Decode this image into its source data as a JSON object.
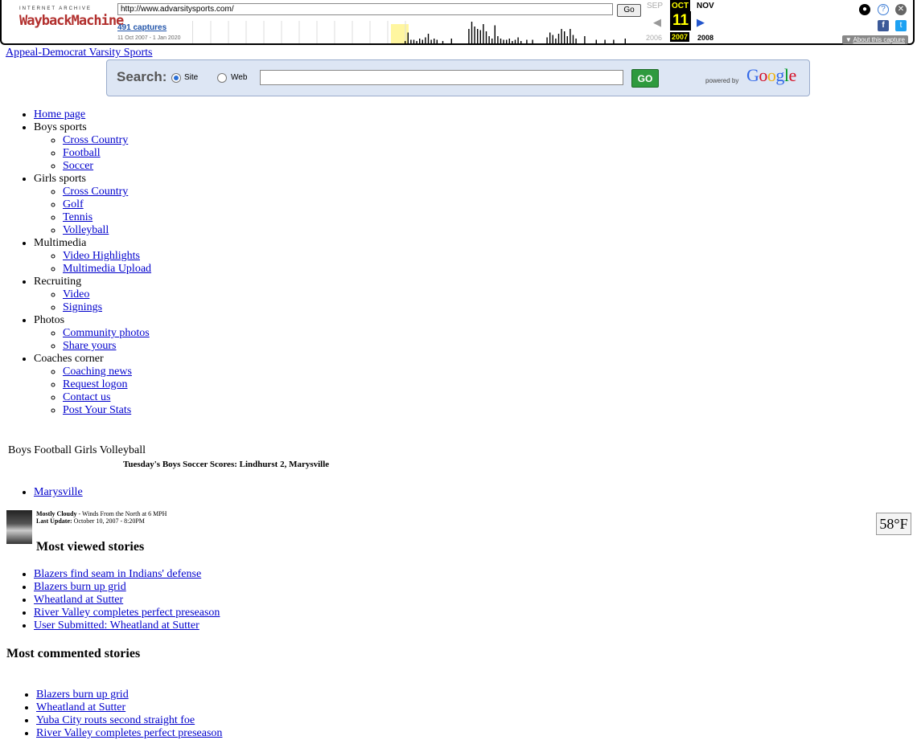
{
  "wayback": {
    "logo_top": "INTERNET ARCHIVE",
    "logo_main": "WaybackMachine",
    "url": "http://www.advarsitysports.com/",
    "go": "Go",
    "captures": "491 captures",
    "range": "11 Oct 2007 - 1 Jan 2020",
    "prev_month": "SEP",
    "cur_month": "OCT",
    "next_month": "NOV",
    "day": "11",
    "prev_year": "2006",
    "cur_year": "2007",
    "next_year": "2008",
    "about": "About this capture",
    "capture_histogram": [
      0,
      0,
      0,
      0,
      0,
      0,
      0,
      0,
      0,
      0,
      0,
      0,
      0,
      0,
      0,
      0,
      0,
      0,
      0,
      0,
      0,
      0,
      0,
      0,
      0,
      0,
      0,
      0,
      0,
      0,
      0,
      0,
      0,
      0,
      0,
      0,
      0,
      0,
      0,
      0,
      0,
      0,
      0,
      0,
      0,
      0,
      0,
      0,
      0,
      0,
      0,
      0,
      0,
      0,
      0,
      0,
      0,
      0,
      0,
      0,
      0,
      0,
      0,
      0,
      0,
      0,
      2,
      9,
      3,
      3,
      2,
      4,
      3,
      5,
      8,
      3,
      4,
      3,
      0,
      2,
      0,
      0,
      4,
      0,
      0,
      0,
      0,
      0,
      12,
      18,
      14,
      12,
      11,
      16,
      10,
      6,
      4,
      15,
      6,
      4,
      3,
      3,
      4,
      2,
      3,
      5,
      2,
      0,
      3,
      0,
      3,
      0,
      0,
      0,
      0,
      5,
      9,
      7,
      4,
      8,
      12,
      10,
      6,
      12,
      7,
      4,
      0,
      0,
      6,
      0,
      0,
      0,
      3,
      0,
      0,
      3,
      0,
      0,
      3,
      0,
      0,
      0,
      4,
      0,
      0,
      0,
      0,
      2,
      0,
      3,
      5,
      0,
      0,
      0
    ]
  },
  "banner_alt": "Appeal-Democrat Varsity Sports",
  "search": {
    "label": "Search:",
    "opt_site": "Site",
    "opt_web": "Web",
    "go": "GO",
    "powered": "powered by",
    "google": "Google"
  },
  "nav": [
    {
      "label": "Home page",
      "link": true,
      "children": []
    },
    {
      "label": "Boys sports",
      "link": false,
      "children": [
        "Cross Country",
        "Football",
        "Soccer"
      ]
    },
    {
      "label": "Girls sports",
      "link": false,
      "children": [
        "Cross Country",
        "Golf",
        "Tennis",
        "Volleyball"
      ]
    },
    {
      "label": "Multimedia",
      "link": false,
      "children": [
        "Video Highlights",
        "Multimedia Upload"
      ]
    },
    {
      "label": "Recruiting",
      "link": false,
      "children": [
        "Video",
        "Signings"
      ]
    },
    {
      "label": "Photos",
      "link": false,
      "children": [
        "Community photos",
        "Share yours"
      ]
    },
    {
      "label": "Coaches corner",
      "link": false,
      "children": [
        "Coaching news",
        "Request logon",
        "Contact us",
        "Post Your Stats"
      ]
    }
  ],
  "tabs": "Boys Football  Girls Volleyball",
  "headline": "Tuesday's Boys Soccer Scores: Lindhurst 2, Marysville",
  "city": "Marysville",
  "weather": {
    "condition": "Mostly Cloudy",
    "wind": " - Winds From the North at 6 MPH",
    "update_label": "Last Update:",
    "update_value": " October 10, 2007 - 8:20PM",
    "temp": "58°F"
  },
  "most_viewed": {
    "title": "Most viewed stories",
    "items": [
      "Blazers find seam in Indians' defense",
      "Blazers burn up grid",
      "Wheatland at Sutter",
      "River Valley completes perfect preseason",
      "User Submitted: Wheatland at Sutter"
    ]
  },
  "most_commented": {
    "title": "Most commented stories",
    "items": [
      "Blazers burn up grid",
      "Wheatland at Sutter",
      "Yuba City routs second straight foe",
      "River Valley completes perfect preseason"
    ]
  }
}
